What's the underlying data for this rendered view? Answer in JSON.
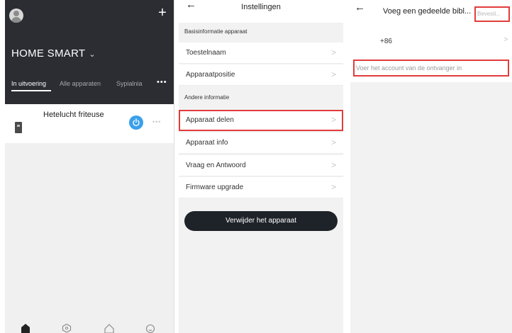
{
  "home": {
    "title": "HOME SMART",
    "title_chevron": "⌄",
    "add_button": "+",
    "tabs": [
      "In uitvoering",
      "Alle apparaten",
      "Sypialnia"
    ],
    "tab_more": "•••",
    "device": {
      "name": "Hetelucht friteuse",
      "more": "•••"
    },
    "colors": {
      "hero": "#2b2d33",
      "power": "#3aa0ea"
    }
  },
  "settings": {
    "back": "←",
    "title": "Instellingen",
    "section_basic": "Basisinformatie apparaat",
    "section_other": "Andere informatie",
    "rows_basic": [
      "Toestelnaam",
      "Apparaatpositie"
    ],
    "rows_other": [
      "Apparaat delen",
      "Apparaat info",
      "Vraag en Antwoord",
      "Firmware upgrade"
    ],
    "arrow": ">",
    "remove_button": "Verwijder het apparaat"
  },
  "share": {
    "back": "←",
    "title": "Voeg een gedeelde bibl...",
    "confirm": "Bevesti...",
    "country_code": "+86",
    "arrow": ">",
    "account_placeholder": "Voer het account van de ontvanger in"
  },
  "highlight_color": "#e23c3c"
}
